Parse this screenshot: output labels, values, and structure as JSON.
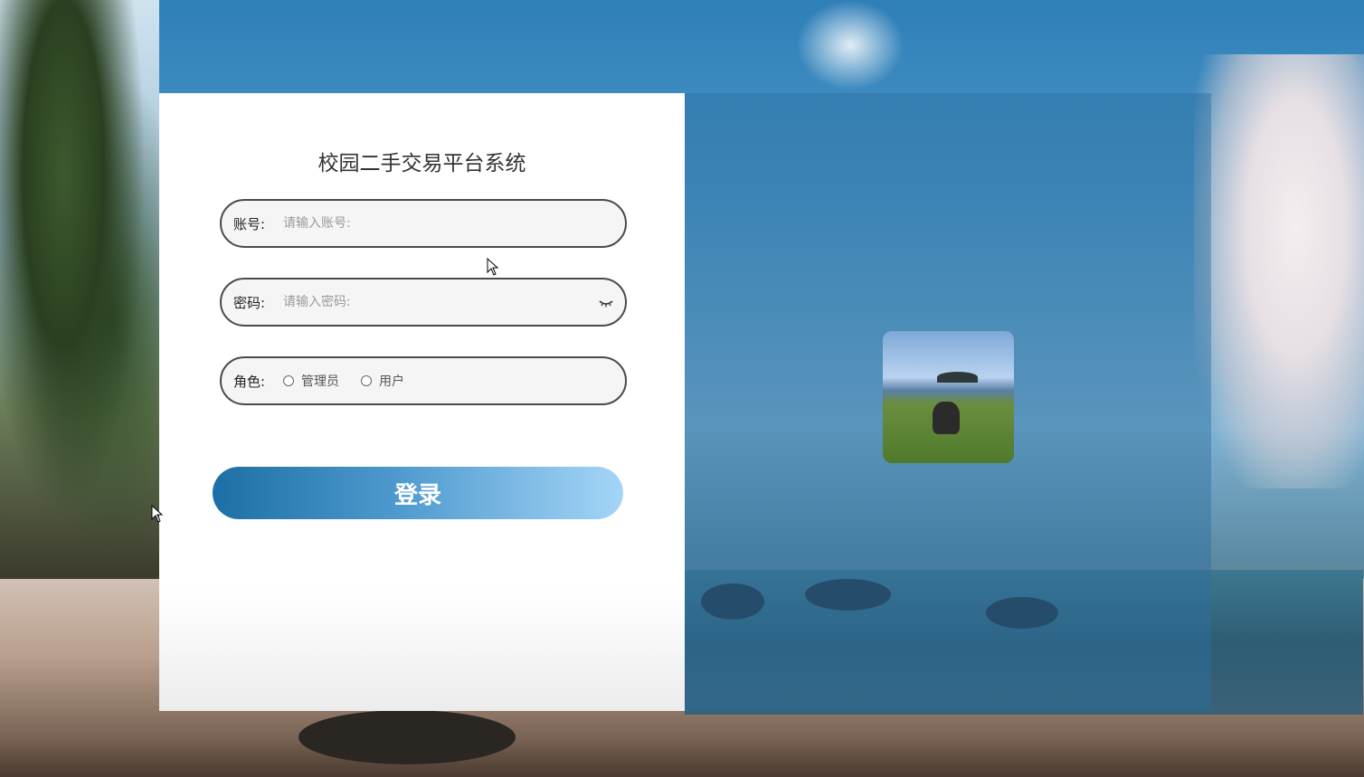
{
  "login": {
    "title": "校园二手交易平台系统",
    "account": {
      "label": "账号:",
      "placeholder": "请输入账号:",
      "value": ""
    },
    "password": {
      "label": "密码:",
      "placeholder": "请输入密码:",
      "value": "",
      "visibility_icon": "eye-closed-icon"
    },
    "role": {
      "label": "角色:",
      "options": [
        {
          "label": "管理员",
          "selected": false
        },
        {
          "label": "用户",
          "selected": false
        }
      ]
    },
    "submit_label": "登录"
  },
  "colors": {
    "button_gradient_start": "#1c6fa4",
    "button_gradient_end": "#a5d5f7",
    "card_background": "#ffffff",
    "field_border": "#4a4a4a"
  }
}
